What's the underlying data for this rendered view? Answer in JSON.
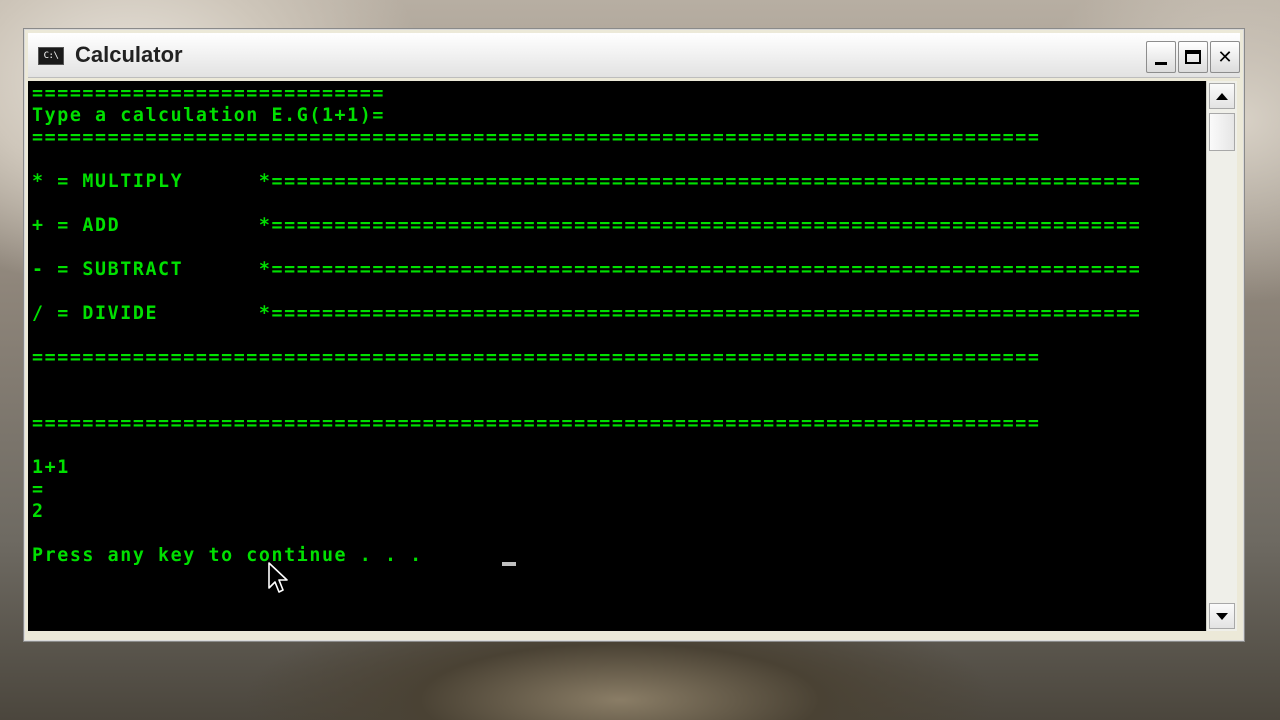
{
  "window": {
    "title": "Calculator",
    "icon_label": "C:\\",
    "icon": "console-app-icon"
  },
  "controls": {
    "minimize_icon": "minimize-icon",
    "maximize_icon": "maximize-icon",
    "close_label": "✕"
  },
  "console": {
    "text_color": "#00e000",
    "background": "#000000",
    "lines": [
      "============================",
      "Type a calculation E.G(1+1)=",
      "================================================================================",
      "",
      "* = MULTIPLY      *=====================================================================",
      "",
      "+ = ADD           *=====================================================================",
      "",
      "- = SUBTRACT      *=====================================================================",
      "",
      "/ = DIVIDE        *=====================================================================",
      "",
      "================================================================================",
      "",
      "",
      "================================================================================",
      "",
      "1+1",
      "=",
      "2",
      "",
      "Press any key to continue . . . "
    ]
  },
  "scrollbar": {
    "up_icon": "scroll-up-arrow-icon",
    "down_icon": "scroll-down-arrow-icon"
  }
}
